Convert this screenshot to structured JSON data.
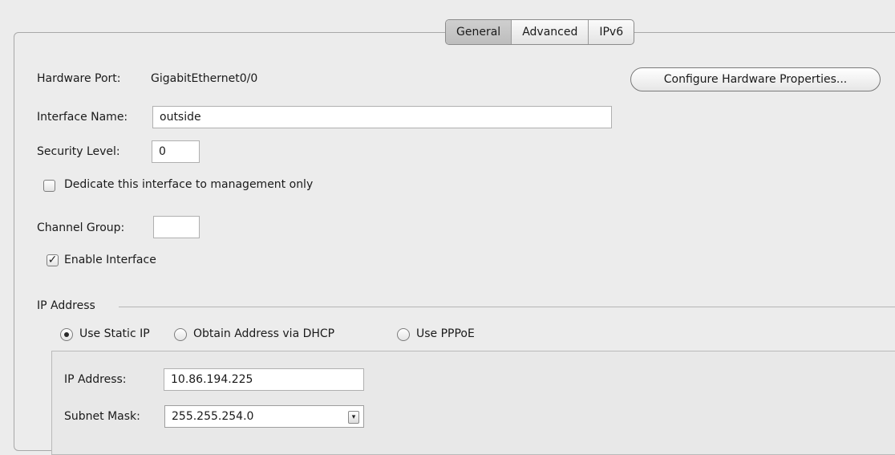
{
  "tabs": [
    {
      "label": "General",
      "active": true
    },
    {
      "label": "Advanced",
      "active": false
    },
    {
      "label": "IPv6",
      "active": false
    }
  ],
  "hardware_port": {
    "label": "Hardware Port:",
    "value": "GigabitEthernet0/0"
  },
  "configure_button": "Configure Hardware Properties...",
  "interface_name": {
    "label": "Interface Name:",
    "value": "outside"
  },
  "security_level": {
    "label": "Security Level:",
    "value": "0"
  },
  "management_only": {
    "label": "Dedicate this interface to management only",
    "checked": false
  },
  "channel_group": {
    "label": "Channel Group:",
    "value": ""
  },
  "enable_interface": {
    "label": "Enable Interface",
    "checked": true,
    "check_glyph": "✓"
  },
  "ip_group": {
    "title": "IP Address",
    "options": [
      {
        "label": "Use Static IP",
        "selected": true
      },
      {
        "label": "Obtain Address via DHCP",
        "selected": false
      },
      {
        "label": "Use PPPoE",
        "selected": false
      }
    ],
    "ip_address": {
      "label": "IP Address:",
      "value": "10.86.194.225"
    },
    "subnet_mask": {
      "label": "Subnet Mask:",
      "value": "255.255.254.0",
      "arrow": "▾"
    }
  }
}
